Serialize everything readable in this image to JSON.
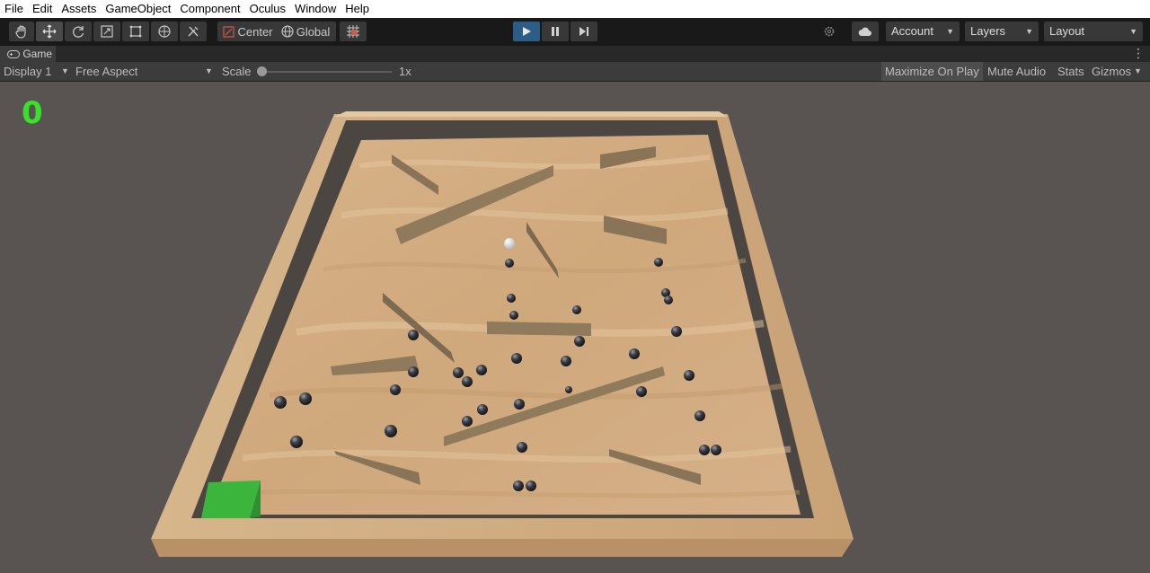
{
  "menu": [
    "File",
    "Edit",
    "Assets",
    "GameObject",
    "Component",
    "Oculus",
    "Window",
    "Help"
  ],
  "toolbar": {
    "pivot_label": "Center",
    "space_label": "Global",
    "account_label": "Account",
    "layers_label": "Layers",
    "layout_label": "Layout",
    "accent": "#2c5d87"
  },
  "game_tab": {
    "label": "Game"
  },
  "game_bar": {
    "display": "Display 1",
    "aspect": "Free Aspect",
    "scale_label": "Scale",
    "scale_value": "1x",
    "maximize": "Maximize On Play",
    "mute": "Mute Audio",
    "stats": "Stats",
    "gizmos": "Gizmos"
  },
  "hud": {
    "score": "0",
    "score_color": "#39e22a"
  },
  "scene": {
    "board_color": "#cfaa7c",
    "frame_color": "#d9b98f",
    "goal_color": "#3cb53c"
  }
}
